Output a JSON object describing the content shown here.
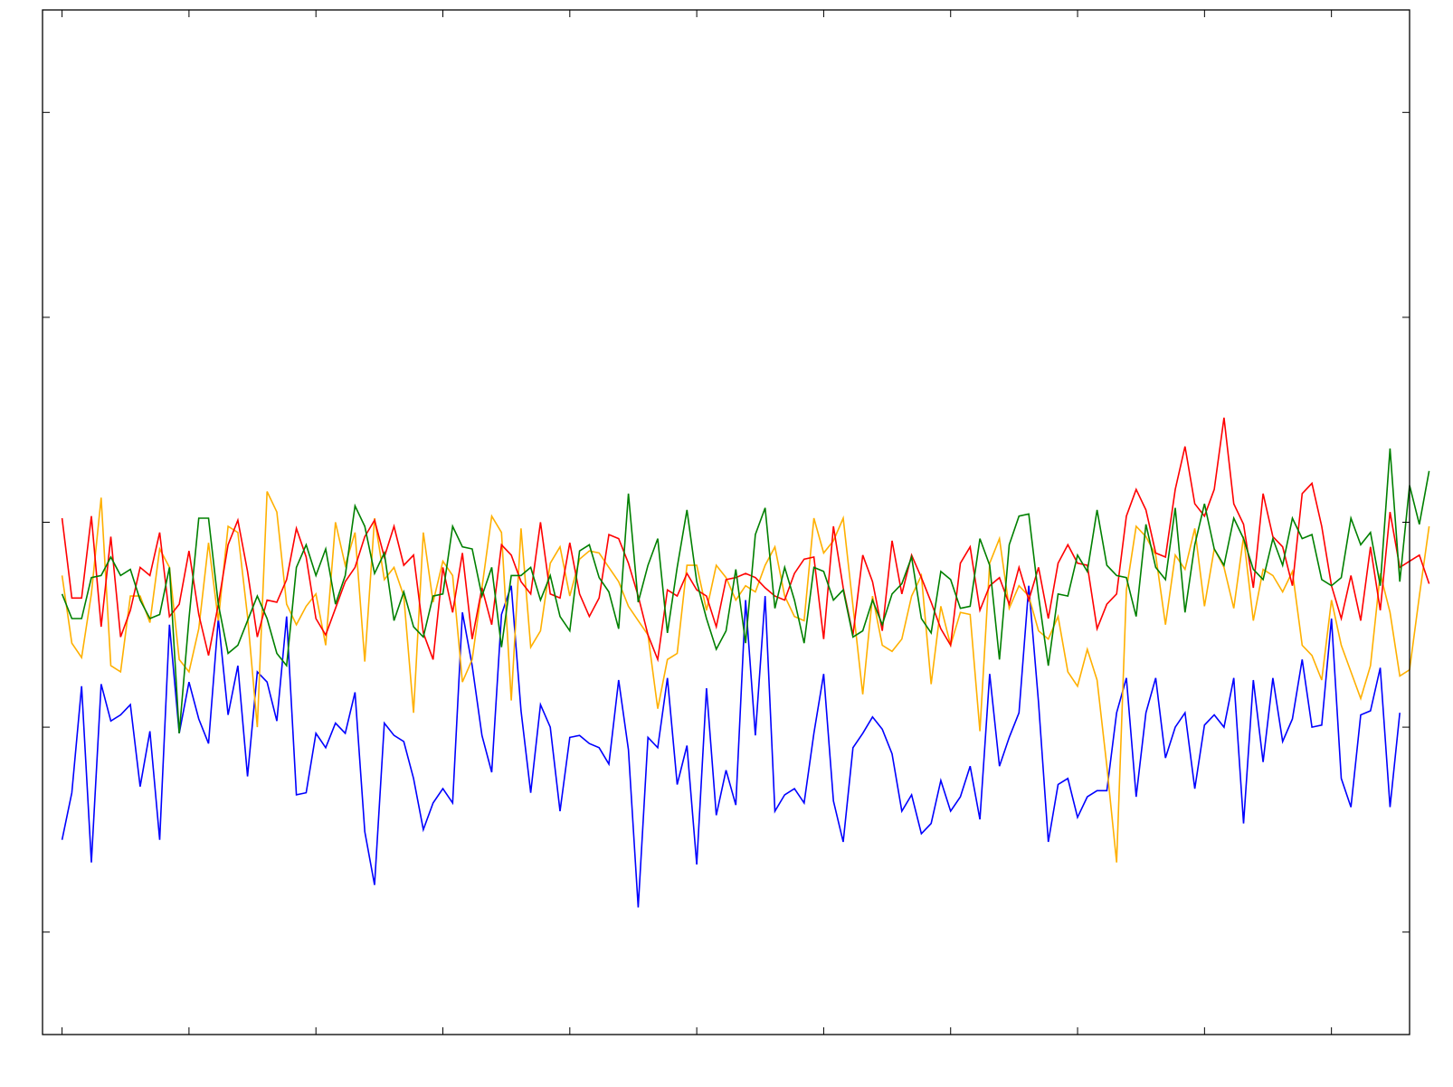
{
  "chart_data": {
    "type": "line",
    "xlim": [
      -2,
      138
    ],
    "ylim": [
      -5,
      0
    ],
    "x_ticks": [
      0,
      13,
      26,
      39,
      52,
      65,
      78,
      91,
      104,
      117,
      130
    ],
    "y_ticks": [
      -4.5,
      -3.5,
      -2.5,
      -1.5,
      -0.5
    ],
    "grid": false,
    "legend": "none",
    "series": [
      {
        "color": "#0000ff",
        "values": [
          -4.05,
          -3.82,
          -3.3,
          -4.16,
          -3.29,
          -3.47,
          -3.44,
          -3.39,
          -3.79,
          -3.52,
          -4.05,
          -3.0,
          -3.53,
          -3.28,
          -3.46,
          -3.58,
          -2.97,
          -3.44,
          -3.2,
          -3.74,
          -3.23,
          -3.28,
          -3.47,
          -2.96,
          -3.83,
          -3.82,
          -3.53,
          -3.6,
          -3.48,
          -3.53,
          -3.33,
          -4.01,
          -4.27,
          -3.48,
          -3.54,
          -3.57,
          -3.75,
          -4.0,
          -3.87,
          -3.8,
          -3.87,
          -2.94,
          -3.2,
          -3.54,
          -3.72,
          -2.95,
          -2.81,
          -3.42,
          -3.82,
          -3.39,
          -3.5,
          -3.91,
          -3.55,
          -3.54,
          -3.58,
          -3.6,
          -3.68,
          -3.27,
          -3.61,
          -4.38,
          -3.55,
          -3.6,
          -3.26,
          -3.78,
          -3.59,
          -4.17,
          -3.31,
          -3.93,
          -3.71,
          -3.88,
          -2.88,
          -3.54,
          -2.86,
          -3.91,
          -3.83,
          -3.8,
          -3.87,
          -3.53,
          -3.24,
          -3.86,
          -4.06,
          -3.6,
          -3.53,
          -3.45,
          -3.51,
          -3.63,
          -3.91,
          -3.83,
          -4.02,
          -3.97,
          -3.76,
          -3.91,
          -3.84,
          -3.69,
          -3.95,
          -3.24,
          -3.69,
          -3.55,
          -3.43,
          -2.81,
          -3.38,
          -4.06,
          -3.78,
          -3.75,
          -3.94,
          -3.84,
          -3.81,
          -3.81,
          -3.43,
          -3.26,
          -3.84,
          -3.43,
          -3.26,
          -3.65,
          -3.5,
          -3.43,
          -3.8,
          -3.49,
          -3.44,
          -3.5,
          -3.26,
          -3.97,
          -3.27,
          -3.67,
          -3.26,
          -3.57,
          -3.46,
          -3.17,
          -3.5,
          -3.49,
          -2.97,
          -3.75,
          -3.89,
          -3.44,
          -3.42,
          -3.21,
          -3.89,
          -3.43
        ]
      },
      {
        "color": "#ffb000",
        "values": [
          -2.76,
          -3.09,
          -3.16,
          -2.85,
          -2.38,
          -3.2,
          -3.23,
          -2.86,
          -2.86,
          -2.99,
          -2.63,
          -2.72,
          -3.17,
          -3.23,
          -3.02,
          -2.6,
          -2.98,
          -2.52,
          -2.55,
          -2.96,
          -3.5,
          -2.35,
          -2.45,
          -2.9,
          -3.0,
          -2.91,
          -2.85,
          -3.1,
          -2.5,
          -2.71,
          -2.55,
          -3.18,
          -2.48,
          -2.78,
          -2.72,
          -2.86,
          -3.43,
          -2.55,
          -2.89,
          -2.69,
          -2.76,
          -3.28,
          -3.17,
          -2.82,
          -2.47,
          -2.55,
          -3.37,
          -2.53,
          -3.11,
          -3.03,
          -2.7,
          -2.62,
          -2.86,
          -2.68,
          -2.64,
          -2.65,
          -2.72,
          -2.79,
          -2.91,
          -2.98,
          -3.05,
          -3.41,
          -3.17,
          -3.14,
          -2.71,
          -2.71,
          -2.93,
          -2.71,
          -2.77,
          -2.88,
          -2.81,
          -2.84,
          -2.71,
          -2.62,
          -2.86,
          -2.96,
          -2.98,
          -2.48,
          -2.65,
          -2.59,
          -2.48,
          -2.91,
          -3.34,
          -2.86,
          -3.1,
          -3.13,
          -3.07,
          -2.86,
          -2.76,
          -3.29,
          -2.91,
          -3.1,
          -2.94,
          -2.95,
          -3.52,
          -2.7,
          -2.58,
          -2.92,
          -2.81,
          -2.86,
          -3.03,
          -3.07,
          -2.96,
          -3.23,
          -3.3,
          -3.12,
          -3.27,
          -3.69,
          -4.16,
          -2.83,
          -2.52,
          -2.57,
          -2.66,
          -3.0,
          -2.66,
          -2.73,
          -2.53,
          -2.91,
          -2.63,
          -2.72,
          -2.92,
          -2.57,
          -2.98,
          -2.73,
          -2.76,
          -2.84,
          -2.74,
          -3.1,
          -3.15,
          -3.27,
          -2.88,
          -3.1,
          -3.23,
          -3.36,
          -3.2,
          -2.75,
          -2.94,
          -3.25,
          -3.22,
          -2.86,
          -2.52
        ]
      },
      {
        "color": "#ff0000",
        "values": [
          -2.48,
          -2.87,
          -2.87,
          -2.47,
          -3.01,
          -2.57,
          -3.06,
          -2.93,
          -2.72,
          -2.76,
          -2.55,
          -2.96,
          -2.9,
          -2.64,
          -2.95,
          -3.15,
          -2.9,
          -2.61,
          -2.49,
          -2.74,
          -3.06,
          -2.88,
          -2.89,
          -2.78,
          -2.53,
          -2.67,
          -2.97,
          -3.05,
          -2.92,
          -2.79,
          -2.72,
          -2.57,
          -2.49,
          -2.67,
          -2.52,
          -2.71,
          -2.66,
          -3.04,
          -3.17,
          -2.72,
          -2.94,
          -2.65,
          -3.07,
          -2.82,
          -3.0,
          -2.61,
          -2.66,
          -2.79,
          -2.85,
          -2.5,
          -2.85,
          -2.87,
          -2.6,
          -2.85,
          -2.96,
          -2.87,
          -2.56,
          -2.58,
          -2.7,
          -2.86,
          -3.05,
          -3.17,
          -2.83,
          -2.86,
          -2.75,
          -2.83,
          -2.86,
          -3.01,
          -2.78,
          -2.77,
          -2.75,
          -2.77,
          -2.82,
          -2.86,
          -2.88,
          -2.75,
          -2.68,
          -2.67,
          -3.07,
          -2.52,
          -2.82,
          -3.05,
          -2.66,
          -2.79,
          -3.03,
          -2.59,
          -2.85,
          -2.66,
          -2.77,
          -2.89,
          -3.02,
          -3.1,
          -2.7,
          -2.62,
          -2.93,
          -2.81,
          -2.77,
          -2.9,
          -2.72,
          -2.88,
          -2.72,
          -2.97,
          -2.7,
          -2.61,
          -2.7,
          -2.71,
          -3.02,
          -2.9,
          -2.85,
          -2.47,
          -2.34,
          -2.44,
          -2.65,
          -2.67,
          -2.34,
          -2.13,
          -2.41,
          -2.47,
          -2.34,
          -1.99,
          -2.41,
          -2.51,
          -2.82,
          -2.36,
          -2.57,
          -2.62,
          -2.81,
          -2.36,
          -2.31,
          -2.52,
          -2.81,
          -2.97,
          -2.76,
          -2.98,
          -2.62,
          -2.93,
          -2.45,
          -2.72,
          -2.69,
          -2.66,
          -2.8
        ]
      },
      {
        "color": "#008000",
        "values": [
          -2.85,
          -2.97,
          -2.97,
          -2.77,
          -2.76,
          -2.67,
          -2.76,
          -2.73,
          -2.88,
          -2.97,
          -2.95,
          -2.72,
          -3.53,
          -2.97,
          -2.48,
          -2.48,
          -2.9,
          -3.14,
          -3.1,
          -2.98,
          -2.86,
          -2.97,
          -3.14,
          -3.2,
          -2.72,
          -2.61,
          -2.76,
          -2.63,
          -2.9,
          -2.76,
          -2.42,
          -2.52,
          -2.75,
          -2.65,
          -2.98,
          -2.84,
          -3.01,
          -3.06,
          -2.86,
          -2.85,
          -2.52,
          -2.62,
          -2.63,
          -2.86,
          -2.72,
          -3.11,
          -2.76,
          -2.76,
          -2.72,
          -2.88,
          -2.76,
          -2.96,
          -3.03,
          -2.64,
          -2.61,
          -2.77,
          -2.84,
          -3.02,
          -2.36,
          -2.89,
          -2.71,
          -2.58,
          -3.04,
          -2.72,
          -2.44,
          -2.79,
          -2.97,
          -3.12,
          -3.03,
          -2.73,
          -3.09,
          -2.56,
          -2.43,
          -2.92,
          -2.72,
          -2.88,
          -3.09,
          -2.72,
          -2.74,
          -2.88,
          -2.83,
          -3.06,
          -3.03,
          -2.88,
          -3.0,
          -2.85,
          -2.8,
          -2.67,
          -2.97,
          -3.04,
          -2.74,
          -2.78,
          -2.92,
          -2.91,
          -2.58,
          -2.71,
          -3.17,
          -2.61,
          -2.47,
          -2.46,
          -2.86,
          -3.2,
          -2.85,
          -2.86,
          -2.66,
          -2.74,
          -2.44,
          -2.71,
          -2.76,
          -2.77,
          -2.96,
          -2.51,
          -2.72,
          -2.78,
          -2.43,
          -2.94,
          -2.61,
          -2.41,
          -2.63,
          -2.71,
          -2.48,
          -2.58,
          -2.73,
          -2.78,
          -2.58,
          -2.71,
          -2.48,
          -2.58,
          -2.56,
          -2.78,
          -2.81,
          -2.77,
          -2.48,
          -2.61,
          -2.55,
          -2.81,
          -2.14,
          -2.79,
          -2.32,
          -2.51,
          -2.25
        ]
      }
    ]
  }
}
